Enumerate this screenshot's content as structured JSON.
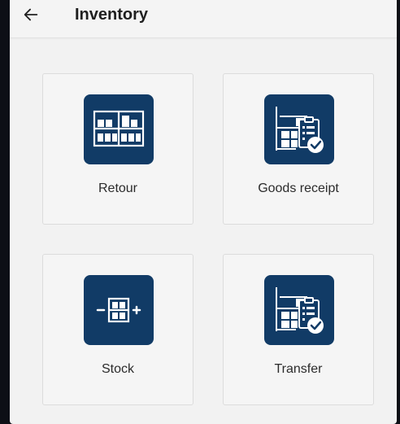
{
  "appbar": {
    "title": "Inventory",
    "back_icon": "arrow-left-icon"
  },
  "colors": {
    "icon_background": "#113b66",
    "screen_background": "#f2f2f2",
    "frame_background": "#0d0f16"
  },
  "tiles": [
    {
      "label": "Retour",
      "icon": "shelf-icon"
    },
    {
      "label": "Goods receipt",
      "icon": "shelf-clipboard-check-icon"
    },
    {
      "label": "Stock",
      "icon": "shelf-plus-minus-icon"
    },
    {
      "label": "Transfer",
      "icon": "shelf-clipboard-check-icon"
    }
  ]
}
